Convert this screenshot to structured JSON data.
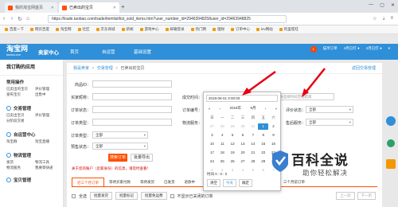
{
  "browser": {
    "tabs": [
      {
        "label": "我的淘宝网首页",
        "active": false
      },
      {
        "label": "已卖出的宝贝",
        "active": true
      }
    ],
    "url": "https://trade.taobao.com/trade/itemlist/list_sold_items.htm?user_number_id=29463948258user_id=29463948825",
    "bookmarks": [
      "百度一下",
      "网页百度",
      "淘宝网",
      "社区",
      "京东商城",
      "新闻",
      "游戏中心",
      "邮箱登录",
      "热门网",
      "理财",
      "订单中心",
      "lev网站",
      "阿里旺旺"
    ]
  },
  "header": {
    "logo": "淘宝网",
    "logo_sub": "taobao.com",
    "title": "卖家中心",
    "nav": [
      "首页",
      "自运营",
      "基础设置"
    ],
    "right_items": [
      "猫享订单",
      "4月已打 ●",
      "4月已打 ●"
    ]
  },
  "sidebar": {
    "title": "我订购的应用",
    "sections": [
      {
        "title": "常用操作",
        "links": [
          "已卖出的宝贝",
          "评价管理",
          "发布宝贝",
          "出售中"
        ]
      },
      {
        "title": "交易管理",
        "links": [
          "已卖出宝贝",
          "评价管理",
          "分阶段交易"
        ]
      },
      {
        "title": "自运营中心",
        "links": [
          "淘宝群",
          "淘宝直播"
        ]
      },
      {
        "title": "物流管理",
        "links": [
          "发货",
          "物流工具",
          "物流服务",
          "我要寄快递"
        ]
      },
      {
        "title": "宝贝管理",
        "links": []
      }
    ]
  },
  "breadcrumb": {
    "home": "我是卖家",
    "mid": "交易管理",
    "current": "已卖出的宝贝",
    "back": "返回交易管理"
  },
  "form": {
    "item_name_label": "商品ID：",
    "buyer_label": "买家昵称：",
    "order_status_label": "订单状态：",
    "order_type_label": "订单类型：",
    "presale_label": "预售状态：",
    "deal_time_label": "成交时间：",
    "order_no_label": "订单编号：",
    "logistics_label": "物流服务：",
    "rate_label": "评价状态：",
    "after_sale_label": "售后服务：",
    "all_label": "全部",
    "time_placeholder": "请选择时间范围结束",
    "search_button": "搜索订单",
    "export_button": "批量导出"
  },
  "notice": "关于您的账户（卖家身份）的信息，请及时查看！",
  "tabs": [
    "近三个月订单",
    "等待买家付款",
    "等待发货",
    "已发货",
    "退款中",
    "需要评价",
    "成功的订单",
    "关闭的订单",
    "三个月前订单"
  ],
  "batch": {
    "select_all": "全选",
    "buttons": [
      "批量发货",
      "批量标记",
      "批量免运费"
    ],
    "checkbox_label": "不显示已关闭的订单"
  },
  "pager": {
    "prev": "上一页",
    "next": "下一页"
  },
  "datepicker": {
    "value": "2018-06-01 0:00:00",
    "year": "2018年",
    "month": "6月",
    "weekdays": [
      "日",
      "一",
      "二",
      "三",
      "四",
      "五",
      "六"
    ],
    "days": [
      [
        "27",
        "28",
        "29",
        "30",
        "31",
        "1",
        "2"
      ],
      [
        "3",
        "4",
        "5",
        "6",
        "7",
        "8",
        "9"
      ],
      [
        "10",
        "11",
        "12",
        "13",
        "14",
        "15",
        "16"
      ],
      [
        "17",
        "18",
        "19",
        "20",
        "21",
        "22",
        "23"
      ],
      [
        "24",
        "25",
        "26",
        "27",
        "28",
        "29",
        "30"
      ],
      [
        "1",
        "2",
        "3",
        "4",
        "5",
        "6",
        "7"
      ]
    ],
    "selected": "1",
    "time": "时间  0 : 0 : 0",
    "buttons": [
      "清空",
      "今天",
      "确定"
    ]
  },
  "watermark": {
    "title": "百科全说",
    "subtitle": "助你轻松解决"
  },
  "colors": {
    "accent": "#ff5000",
    "brand": "#2f8fd8",
    "arrow": "#e60012"
  }
}
